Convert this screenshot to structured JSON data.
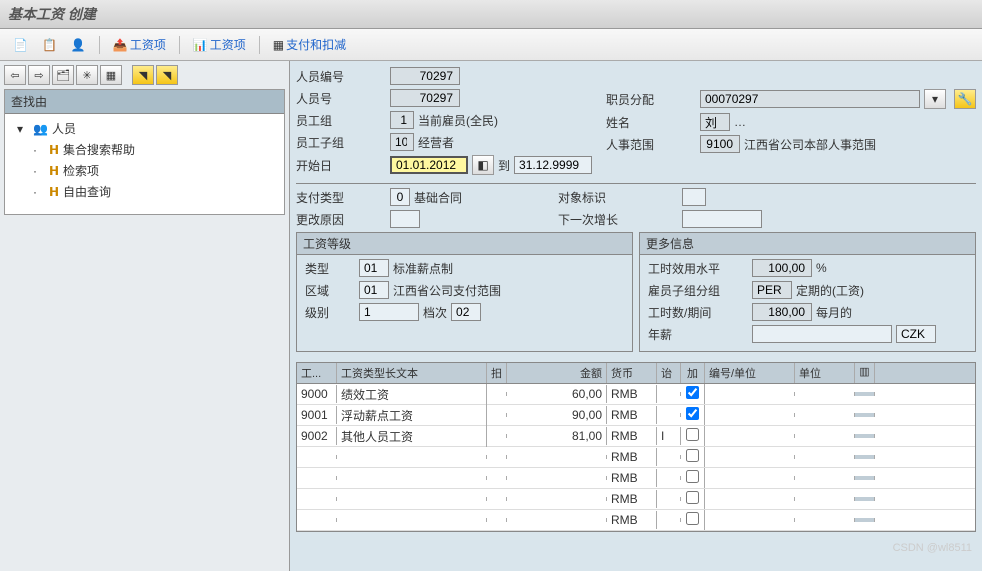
{
  "title": "基本工资 创建",
  "toolbar": {
    "wage_item": "工资项",
    "wage_levels": "工资项",
    "payments_deductions": "支付和扣减"
  },
  "tree": {
    "header": "查找由",
    "root": "人员",
    "items": [
      "集合搜索帮助",
      "检索项",
      "自由查询"
    ]
  },
  "form": {
    "person_no_label": "人员编号",
    "person_no": "70297",
    "person_id_label": "人员号",
    "person_id": "70297",
    "emp_group_label": "员工组",
    "emp_group": "1",
    "emp_group_text": "当前雇员(全民)",
    "emp_subgroup_label": "员工子组",
    "emp_subgroup": "10",
    "emp_subgroup_text": "经营者",
    "start_date_label": "开始日",
    "start_date": "01.01.2012",
    "to": "到",
    "end_date": "31.12.9999",
    "assign_label": "职员分配",
    "assign_val": "00070297",
    "name_label": "姓名",
    "name_val": "刘",
    "hr_area_label": "人事范围",
    "hr_area": "9100",
    "hr_area_text": "江西省公司本部人事范围"
  },
  "pay": {
    "pay_type_label": "支付类型",
    "pay_type": "0",
    "pay_type_text": "基础合同",
    "obj_flag_label": "对象标识",
    "change_reason_label": "更改原因",
    "next_increase_label": "下一次增长"
  },
  "grade": {
    "title": "工资等级",
    "type_label": "类型",
    "type": "01",
    "type_text": "标准薪点制",
    "region_label": "区域",
    "region": "01",
    "region_text": "江西省公司支付范围",
    "level_label": "级别",
    "level": "1",
    "step_label": "档次",
    "step": "02"
  },
  "more": {
    "title": "更多信息",
    "cap_util_label": "工时效用水平",
    "cap_util": "100,00",
    "cap_util_unit": "%",
    "ee_label": "雇员子组分组",
    "ee": "PER",
    "ee_text": "定期的(工资)",
    "hours_label": "工时数/期间",
    "hours": "180,00",
    "hours_unit": "每月的",
    "annual_label": "年薪",
    "annual_cur": "CZK"
  },
  "table": {
    "headers": {
      "c1": "工...",
      "c2": "工资类型长文本",
      "c3": "抇",
      "c4": "金额",
      "c5": "货币",
      "c6": "诒",
      "c7": "加",
      "c8": "编号/单位",
      "c9": "单位"
    },
    "rows": [
      {
        "code": "9000",
        "text": "绩效工资",
        "amount": "60,00",
        "cur": "RMB",
        "flag": "",
        "chk": true
      },
      {
        "code": "9001",
        "text": "浮动薪点工资",
        "amount": "90,00",
        "cur": "RMB",
        "flag": "",
        "chk": true
      },
      {
        "code": "9002",
        "text": "其他人员工资",
        "amount": "81,00",
        "cur": "RMB",
        "flag": "I",
        "chk": false
      },
      {
        "code": "",
        "text": "",
        "amount": "",
        "cur": "RMB",
        "flag": "",
        "chk": false
      },
      {
        "code": "",
        "text": "",
        "amount": "",
        "cur": "RMB",
        "flag": "",
        "chk": false
      },
      {
        "code": "",
        "text": "",
        "amount": "",
        "cur": "RMB",
        "flag": "",
        "chk": false
      },
      {
        "code": "",
        "text": "",
        "amount": "",
        "cur": "RMB",
        "flag": "",
        "chk": false
      }
    ]
  },
  "watermark": "CSDN @wl8511"
}
